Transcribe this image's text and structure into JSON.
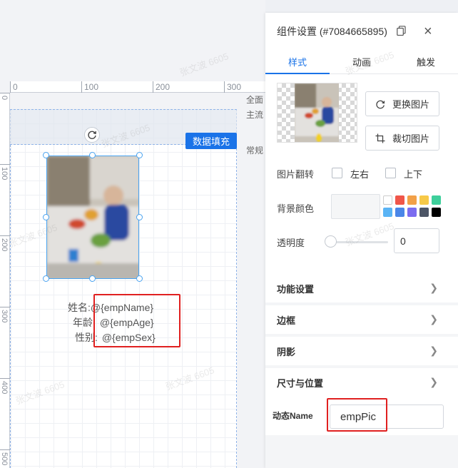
{
  "canvas": {
    "ruler_h_labels": [
      "0",
      "100",
      "200",
      "300"
    ],
    "ruler_v_labels": [
      "0",
      "100",
      "200",
      "300",
      "400",
      "500"
    ],
    "side_labels": [
      "全面",
      "主流",
      "常规"
    ],
    "fill_tag": "数据填充",
    "fields": [
      {
        "label": "姓名:",
        "value": "@{empName}"
      },
      {
        "label": "年龄:",
        "value": "@{empAge}"
      },
      {
        "label": "性别:",
        "value": "@{empSex}"
      }
    ],
    "watermark": "张文波 6605"
  },
  "panel": {
    "title": "组件设置 (#7084665895)",
    "tabs": [
      {
        "label": "样式",
        "active": true
      },
      {
        "label": "动画",
        "active": false
      },
      {
        "label": "触发",
        "active": false
      }
    ],
    "replace_image": "更换图片",
    "crop_image": "裁切图片",
    "flip_label": "图片翻转",
    "flip_lr": "左右",
    "flip_ud": "上下",
    "bg_color_label": "背景颜色",
    "swatches": [
      "#ffffff",
      "#f0564a",
      "#f2a048",
      "#f7c948",
      "#3ecf9b",
      "#5ab4f5",
      "#4a86e8",
      "#7b6cf0",
      "#4d5566",
      "#000000"
    ],
    "opacity_label": "透明度",
    "opacity_value": "0",
    "sections": [
      "功能设置",
      "边框",
      "阴影",
      "尺寸与位置"
    ],
    "dynamic_name_label": "动态Name",
    "dynamic_name_value": "empPic"
  }
}
